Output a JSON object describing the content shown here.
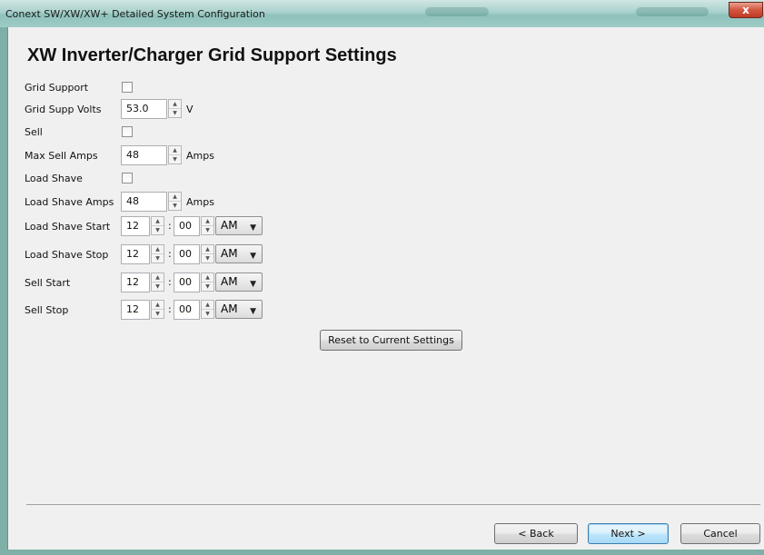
{
  "window": {
    "title": "Conext SW/XW/XW+ Detailed System Configuration",
    "close_label": "x"
  },
  "page": {
    "heading": "XW Inverter/Charger Grid Support Settings"
  },
  "fields": {
    "grid_support": {
      "label": "Grid Support",
      "checked": false
    },
    "grid_supp_volts": {
      "label": "Grid Supp Volts",
      "value": "53.0",
      "unit": "V"
    },
    "sell": {
      "label": "Sell",
      "checked": false
    },
    "max_sell_amps": {
      "label": "Max Sell Amps",
      "value": "48",
      "unit": "Amps"
    },
    "load_shave": {
      "label": "Load Shave",
      "checked": false
    },
    "load_shave_amps": {
      "label": "Load Shave Amps",
      "value": "48",
      "unit": "Amps"
    }
  },
  "time_rows": [
    {
      "label": "Load Shave Start",
      "hour": "12",
      "minute": "00",
      "ampm": "AM"
    },
    {
      "label": "Load Shave Stop",
      "hour": "12",
      "minute": "00",
      "ampm": "AM"
    },
    {
      "label": "Sell Start",
      "hour": "12",
      "minute": "00",
      "ampm": "AM"
    },
    {
      "label": "Sell Stop",
      "hour": "12",
      "minute": "00",
      "ampm": "AM"
    }
  ],
  "time_separator": ":",
  "buttons": {
    "reset": "Reset to Current Settings",
    "back": "< Back",
    "next": "Next >",
    "cancel": "Cancel"
  },
  "icons": {
    "spin_up": "▲",
    "spin_down": "▼",
    "dropdown": "▼"
  }
}
